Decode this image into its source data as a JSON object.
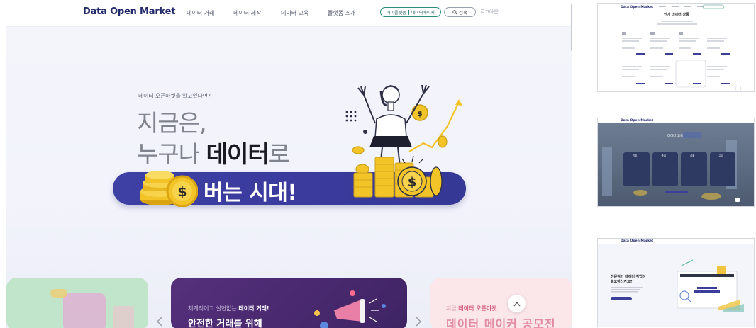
{
  "brand": {
    "logo": "Data Open Market"
  },
  "nav": {
    "items": [
      "데이터 거래",
      "데이터 제작",
      "데이터 교육",
      "플랫폼 소개"
    ],
    "pill_left": "마이플랫폼",
    "pill_right": "데이터메이커",
    "search": "검색",
    "login": "로그아웃"
  },
  "hero": {
    "subtitle": "데이터 오픈마켓을 알고있다면?",
    "line1": "지금은,",
    "line2_pre": "누구나 ",
    "line2_bold": "데이터",
    "line2_post": "로",
    "band": "버는 시대!"
  },
  "cards": {
    "center_sub_pre": "체계적이고 실현없는 ",
    "center_sub_bold": "데이터 거래!",
    "center_main": "안전한 거래를 위해",
    "right_sub_pre": "지금 ",
    "right_sub_bold": "데이터 오픈마켓",
    "right_main": "데이터 메이커 공모전"
  },
  "icons": {
    "prev": "chevron-left-icon",
    "next": "chevron-right-icon",
    "scroll_top": "arrow-up-icon",
    "search": "search-icon"
  },
  "thumbs": {
    "t1_title": "인기 데이터 상품",
    "t1_price": "7,500 원",
    "t1_item": "음성기반 운동분석 데이터 판매합니다",
    "t2_title": "데이터 교육",
    "t2_labels": [
      "기초",
      "중급",
      "심화",
      "고급"
    ],
    "t3_title_1": "전문적인 데이터 작업이",
    "t3_title_2": "필요하신가요?",
    "t3_button": "데이터 메이커 보기"
  },
  "colors": {
    "brand_navy": "#232a6b",
    "band_purple": "#3f40a4",
    "teal": "#2a8c7a",
    "card_purple": "#4a2970",
    "coin_gold": "#f2c428"
  }
}
